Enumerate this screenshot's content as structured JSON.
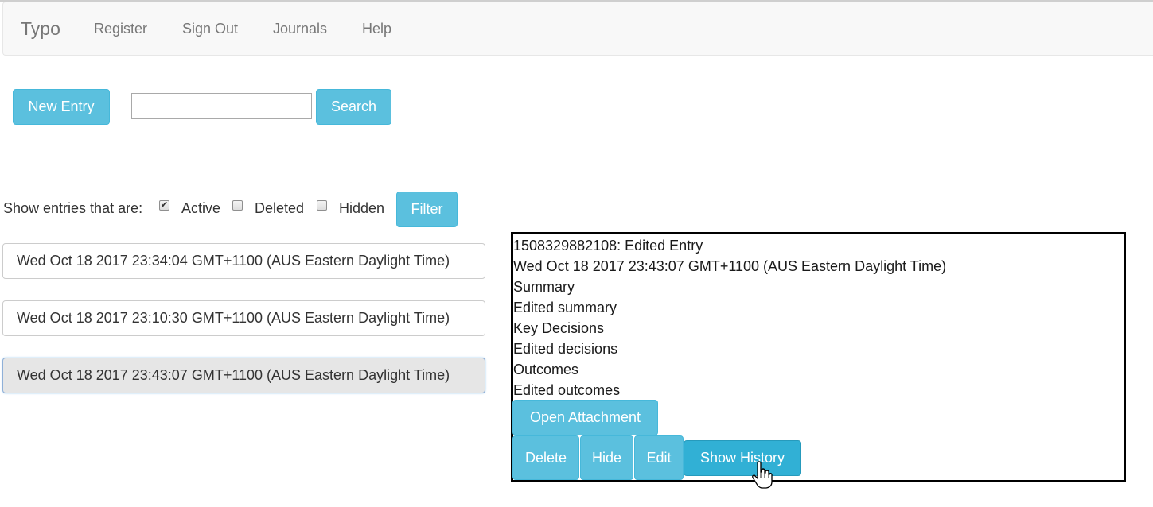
{
  "navbar": {
    "brand": "Typo",
    "links": [
      "Register",
      "Sign Out",
      "Journals",
      "Help"
    ]
  },
  "toolbar": {
    "new_entry_label": "New Entry",
    "search_value": "",
    "search_label": "Search"
  },
  "filter": {
    "prompt": "Show entries that are:",
    "options": [
      {
        "label": "Active",
        "checked": true
      },
      {
        "label": "Deleted",
        "checked": false
      },
      {
        "label": "Hidden",
        "checked": false
      }
    ],
    "button_label": "Filter"
  },
  "entries": [
    {
      "label": "Wed Oct 18 2017 23:34:04 GMT+1100 (AUS Eastern Daylight Time)",
      "selected": false
    },
    {
      "label": "Wed Oct 18 2017 23:10:30 GMT+1100 (AUS Eastern Daylight Time)",
      "selected": false
    },
    {
      "label": "Wed Oct 18 2017 23:43:07 GMT+1100 (AUS Eastern Daylight Time)",
      "selected": true
    }
  ],
  "detail": {
    "heading": "1508329882108: Edited Entry",
    "timestamp": "Wed Oct 18 2017 23:43:07 GMT+1100 (AUS Eastern Daylight Time)",
    "summary_label": "Summary",
    "summary_value": "Edited summary",
    "decisions_label": "Key Decisions",
    "decisions_value": "Edited decisions",
    "outcomes_label": "Outcomes",
    "outcomes_value": "Edited outcomes",
    "open_attachment_label": "Open Attachment",
    "delete_label": "Delete",
    "hide_label": "Hide",
    "edit_label": "Edit",
    "show_history_label": "Show History"
  },
  "colors": {
    "button_info": "#5bc0de",
    "button_info_active": "#31b0d5",
    "navbar_bg": "#f8f8f8",
    "nav_text": "#777777"
  },
  "icons": {
    "checkmark": "check-icon",
    "cursor": "hand-pointer-icon"
  }
}
